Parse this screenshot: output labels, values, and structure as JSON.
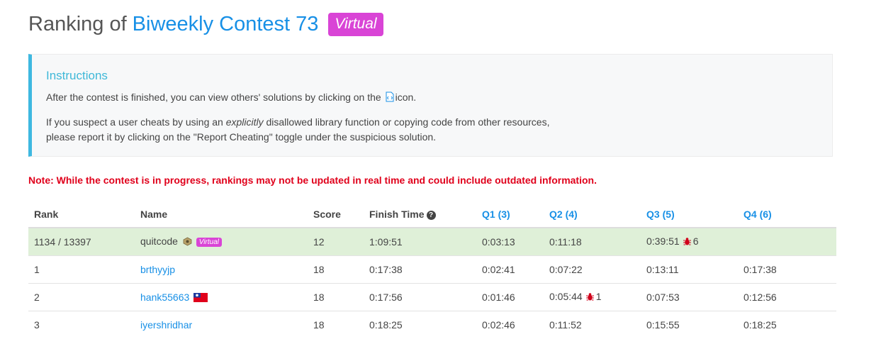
{
  "header": {
    "prefix": "Ranking of",
    "contest_name": "Biweekly Contest 73",
    "badge": "Virtual"
  },
  "instructions": {
    "title": "Instructions",
    "line1_before": "After the contest is finished, you can view others' solutions by clicking on the",
    "line1_after": "icon.",
    "line2_before": "If you suspect a user cheats by using an",
    "line2_emphasis": "explicitly",
    "line2_after": "disallowed library function or copying code from other resources,",
    "line3": "please report it by clicking on the \"Report Cheating\" toggle under the suspicious solution."
  },
  "note": "Note: While the contest is in progress, rankings may not be updated in real time and could include outdated information.",
  "table": {
    "headers": {
      "rank": "Rank",
      "name": "Name",
      "score": "Score",
      "finish_time": "Finish Time",
      "q1": "Q1 (3)",
      "q2": "Q2 (4)",
      "q3": "Q3 (5)",
      "q4": "Q4 (6)"
    },
    "self_row": {
      "rank": "1134 / 13397",
      "name": "quitcode",
      "badge": "Virtual",
      "score": "12",
      "finish_time": "1:09:51",
      "q1": "0:03:13",
      "q2": "0:11:18",
      "q3": "0:39:51",
      "q3_penalty": "6",
      "q4": ""
    },
    "rows": [
      {
        "rank": "1",
        "name": "brthyyjp",
        "score": "18",
        "finish_time": "0:17:38",
        "q1": "0:02:41",
        "q2": "0:07:22",
        "q3": "0:13:11",
        "q4": "0:17:38"
      },
      {
        "rank": "2",
        "name": "hank55663",
        "score": "18",
        "finish_time": "0:17:56",
        "q1": "0:01:46",
        "q2": "0:05:44",
        "q2_penalty": "1",
        "q3": "0:07:53",
        "q4": "0:12:56"
      },
      {
        "rank": "3",
        "name": "iyershridhar",
        "score": "18",
        "finish_time": "0:18:25",
        "q1": "0:02:46",
        "q2": "0:11:52",
        "q3": "0:15:55",
        "q4": "0:18:25"
      }
    ]
  },
  "colors": {
    "accent": "#1890e6",
    "virtual_badge": "#d944d6",
    "note_red": "#e0001b",
    "self_row_bg": "#dff0d8",
    "instructions_border": "#3eb8e0"
  }
}
